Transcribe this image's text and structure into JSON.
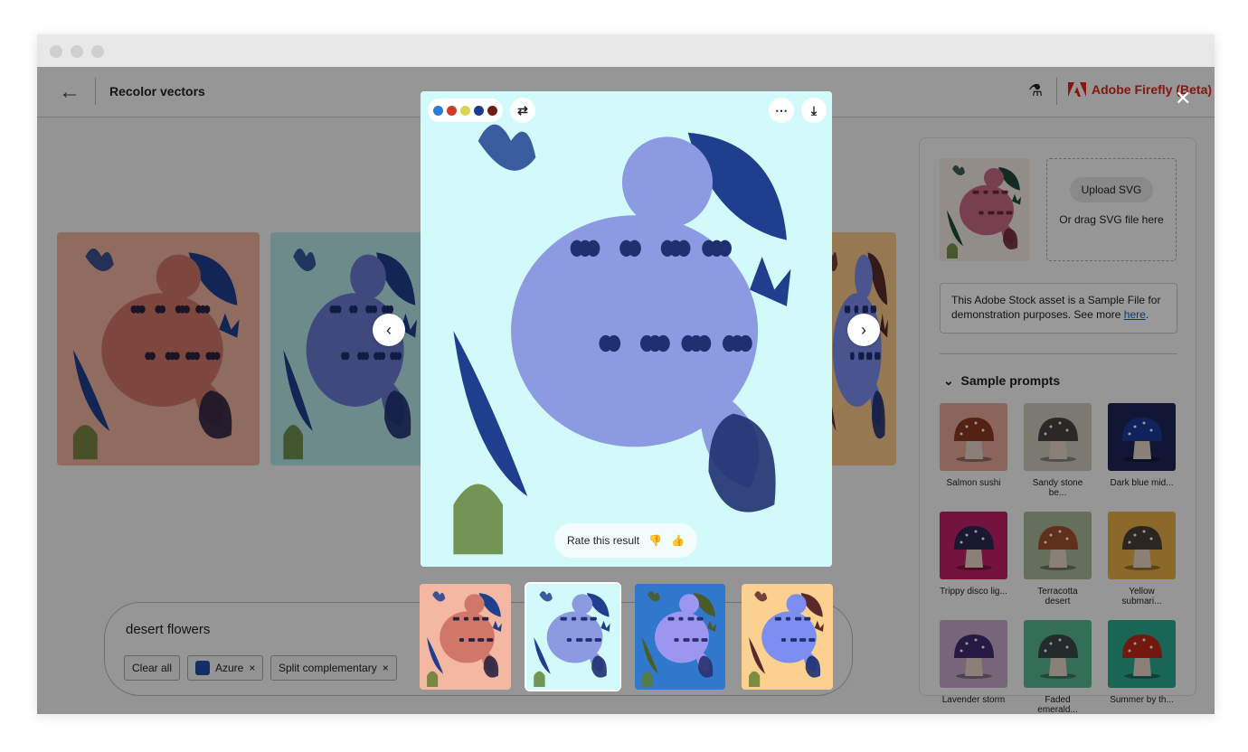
{
  "header": {
    "title": "Recolor vectors",
    "brand": "Adobe Firefly (Beta)"
  },
  "panel": {
    "upload_button": "Upload SVG",
    "drag_text": "Or drag SVG file here",
    "notice_text": "This Adobe Stock asset is a Sample File for demonstration purposes. See more ",
    "notice_link": "here",
    "section_title": "Sample prompts",
    "prompts": [
      {
        "label": "Salmon sushi",
        "bg": "#e8a898",
        "cap": "#8a3a22"
      },
      {
        "label": "Sandy stone be...",
        "bg": "#cfcabc",
        "cap": "#4a4440"
      },
      {
        "label": "Dark blue mid...",
        "bg": "#1c2555",
        "cap": "#1a3a99"
      },
      {
        "label": "Trippy disco lig...",
        "bg": "#c4206a",
        "cap": "#2a2850"
      },
      {
        "label": "Terracotta desert",
        "bg": "#aab79a",
        "cap": "#a05030"
      },
      {
        "label": "Yellow submari...",
        "bg": "#e8b048",
        "cap": "#4a4038"
      },
      {
        "label": "Lavender storm",
        "bg": "#c8a8cc",
        "cap": "#402a70"
      },
      {
        "label": "Faded emerald...",
        "bg": "#58b890",
        "cap": "#3a4a48"
      },
      {
        "label": "Summer by th...",
        "bg": "#2aa890",
        "cap": "#c02818"
      }
    ]
  },
  "prompt_bar": {
    "text": "desert flowers",
    "clear_all": "Clear all",
    "chips": [
      {
        "label": "Azure",
        "color": "#1f4fa8"
      },
      {
        "label": "Split complementary"
      }
    ]
  },
  "modal": {
    "palette": [
      "#2f7bd6",
      "#cc3a2a",
      "#d8d850",
      "#1d3c8a",
      "#6e1f14"
    ],
    "rate_label": "Rate this result",
    "bg": "#d2fafa"
  },
  "variations": [
    {
      "bg": "#f3b7a2",
      "body": "#d0776a",
      "leaf": "#1f3f8e",
      "dots": "#2a2240"
    },
    {
      "bg": "#d2fafa",
      "body": "#8c9ae2",
      "leaf": "#1f3f8e",
      "dots": "#1f3070"
    },
    {
      "bg": "#2f78cc",
      "body": "#9c96f0",
      "leaf": "#4a5a28",
      "dots": "#2a3070"
    },
    {
      "bg": "#fbd090",
      "body": "#7c8ef0",
      "leaf": "#5a2a2a",
      "dots": "#1f2f70"
    }
  ],
  "background_cards": [
    {
      "bg": "#f0b3a0",
      "body": "#d0776a",
      "leaf": "#1f3f8e",
      "dots": "#2a2240"
    },
    {
      "bg": "#b8e8ea",
      "body": "#6a7ad0",
      "leaf": "#1f3f8e",
      "dots": "#1f3070"
    },
    {
      "bg": "#fbc88a",
      "body": "#7c8ef0",
      "leaf": "#5a2a2a",
      "dots": "#1f2f70"
    }
  ],
  "source_art": {
    "bg": "#f3ece4",
    "body": "#c86a86",
    "leaf": "#1f4a38",
    "dots": "#6a2a3a"
  }
}
